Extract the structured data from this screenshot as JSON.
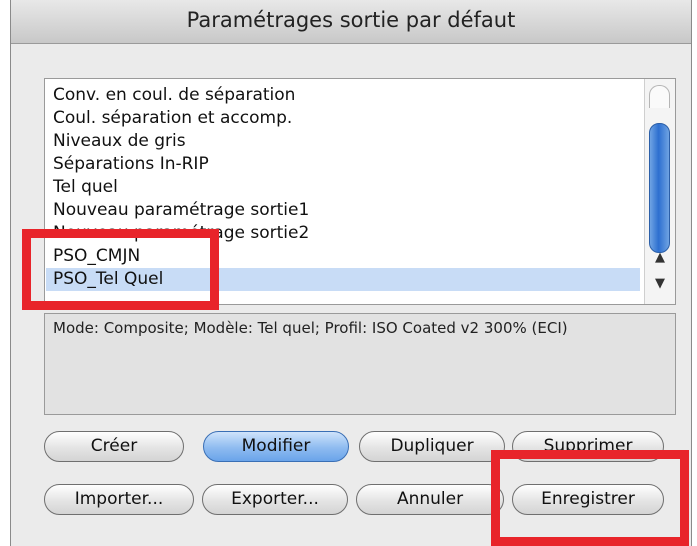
{
  "dialog": {
    "title": "Paramétrages sortie par défaut"
  },
  "list": {
    "items": [
      {
        "label": "Conv. en coul. de séparation"
      },
      {
        "label": "Coul. séparation et accomp."
      },
      {
        "label": "Niveaux de gris"
      },
      {
        "label": "Séparations In-RIP"
      },
      {
        "label": "Tel quel"
      },
      {
        "label": "Nouveau paramétrage sortie1"
      },
      {
        "label": "Nouveau paramétrage sortie2"
      },
      {
        "label": "PSO_CMJN"
      },
      {
        "label": "PSO_Tel Quel"
      }
    ],
    "selected_index": 8
  },
  "description": "Mode: Composite; Modèle: Tel quel; Profil: ISO Coated v2 300% (ECI)",
  "buttons": {
    "create": "Créer",
    "modify": "Modifier",
    "duplicate": "Dupliquer",
    "delete": "Supprimer",
    "import": "Importer...",
    "export": "Exporter...",
    "cancel": "Annuler",
    "save": "Enregistrer"
  },
  "colors": {
    "highlight": "#e8242a",
    "selection": "#c8dcf6",
    "default_button": "#6aa4ea"
  }
}
